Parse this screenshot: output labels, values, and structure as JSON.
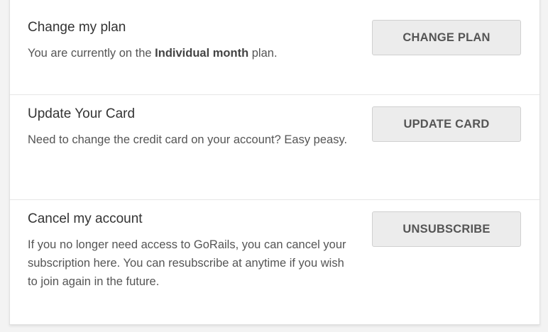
{
  "sections": {
    "change_plan": {
      "heading": "Change my plan",
      "desc_prefix": "You are currently on the ",
      "desc_plan": "Individual month",
      "desc_suffix": " plan.",
      "button": "CHANGE PLAN"
    },
    "update_card": {
      "heading": "Update Your Card",
      "desc": "Need to change the credit card on your account? Easy peasy.",
      "button": "UPDATE CARD"
    },
    "cancel_account": {
      "heading": "Cancel my account",
      "desc": "If you no longer need access to GoRails, you can cancel your subscription here. You can resubscribe at anytime if you wish to join again in the future.",
      "button": "UNSUBSCRIBE"
    }
  },
  "colors": {
    "page_background": "#f3f3f3",
    "card_background": "#ffffff",
    "button_background": "#ececec",
    "button_text": "#555555"
  }
}
